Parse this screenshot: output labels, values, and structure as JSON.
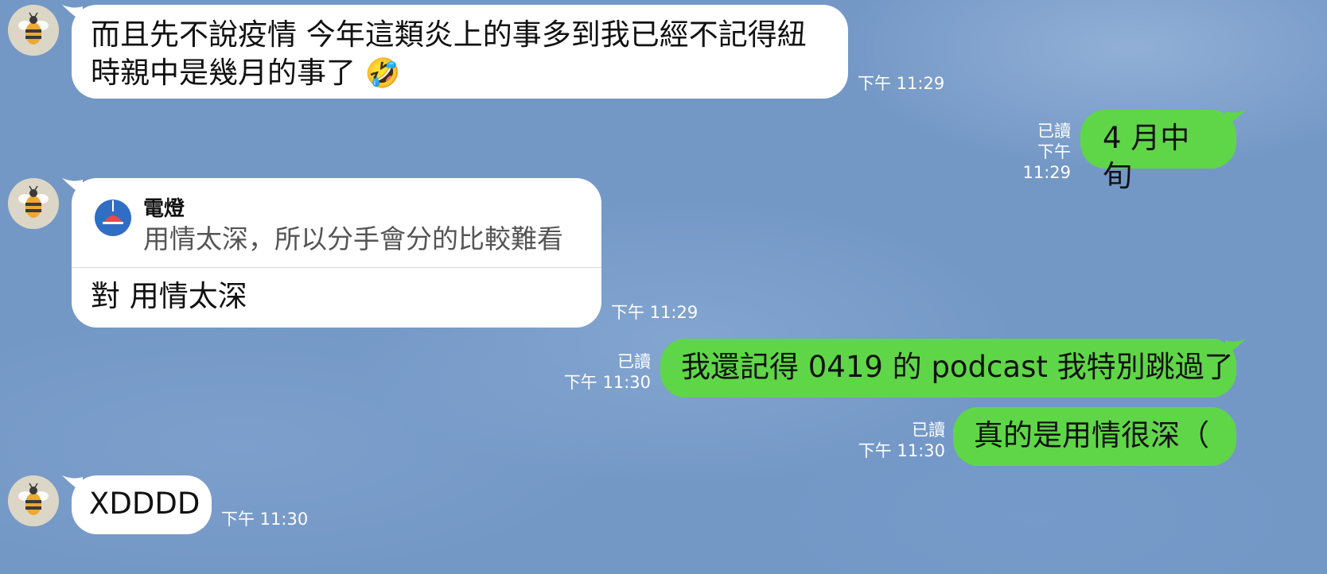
{
  "messages": [
    {
      "direction": "in",
      "text_line1": "而且先不說疫情 今年這類炎上的事多到我已經不記得紐",
      "text_line2": "時親中是幾月的事了",
      "emoji": "🤣",
      "time": "下午 11:29"
    },
    {
      "direction": "out",
      "text": "4 月中旬",
      "read": "已讀",
      "time": "下午 11:29"
    },
    {
      "direction": "in",
      "reply_sender": "電燈",
      "reply_quote": "用情太深，所以分手會分的比較難看",
      "text": "對 用情太深",
      "time": "下午 11:29"
    },
    {
      "direction": "out",
      "text": "我還記得 0419 的 podcast 我特別跳過了",
      "read": "已讀",
      "time": "下午 11:30"
    },
    {
      "direction": "out",
      "text": "真的是用情很深（",
      "read": "已讀",
      "time": "下午 11:30"
    },
    {
      "direction": "in",
      "text": "XDDDD",
      "time": "下午 11:30"
    }
  ],
  "colors": {
    "background": "#7498c6",
    "incoming_bubble": "#ffffff",
    "outgoing_bubble": "#5fd648",
    "meta_text": "#ffffff"
  },
  "icons": {
    "avatar": "bee-avatar-icon",
    "reply": "lamp-icon"
  }
}
